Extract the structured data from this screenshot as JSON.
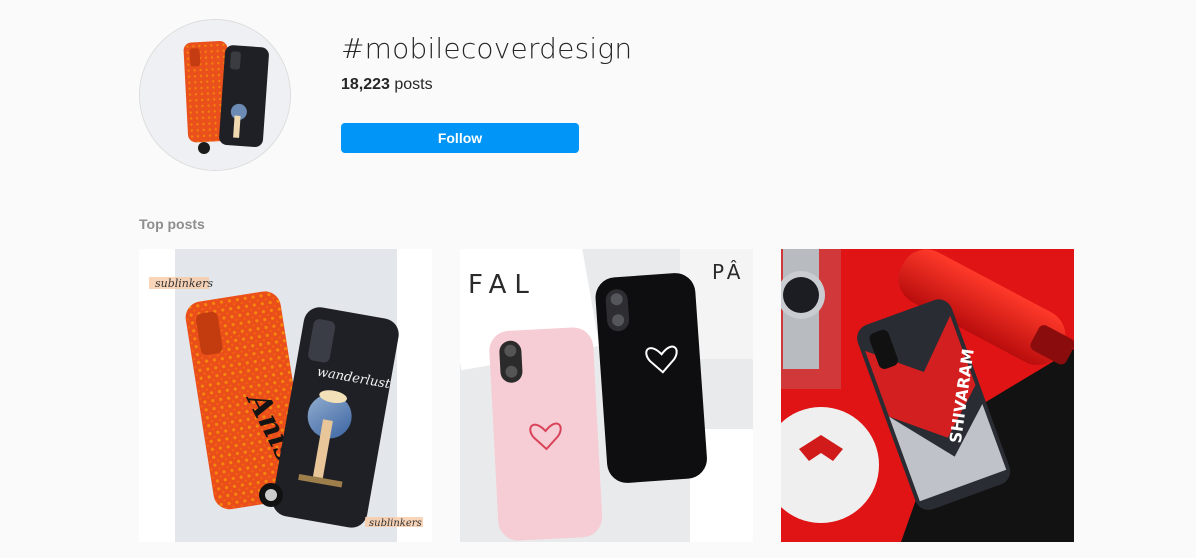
{
  "hashtag": {
    "title": "#mobilecoverdesign",
    "post_count": "18,223",
    "post_count_suffix": " posts",
    "follow_label": "Follow"
  },
  "sections": {
    "top_posts_label": "Top posts"
  },
  "posts": [
    {
      "id": "post-1",
      "phone_left_text": "Anish",
      "phone_right_text": "wanderlust",
      "brand_watermark": "sublinkers"
    },
    {
      "id": "post-2",
      "backdrop_text_left": "FAL",
      "backdrop_text_right": "PÂ"
    },
    {
      "id": "post-3",
      "phone_text": "SHIVARAM"
    }
  ],
  "colors": {
    "accent": "#0095f6",
    "background": "#fafafa",
    "muted": "#8e8e8e"
  }
}
